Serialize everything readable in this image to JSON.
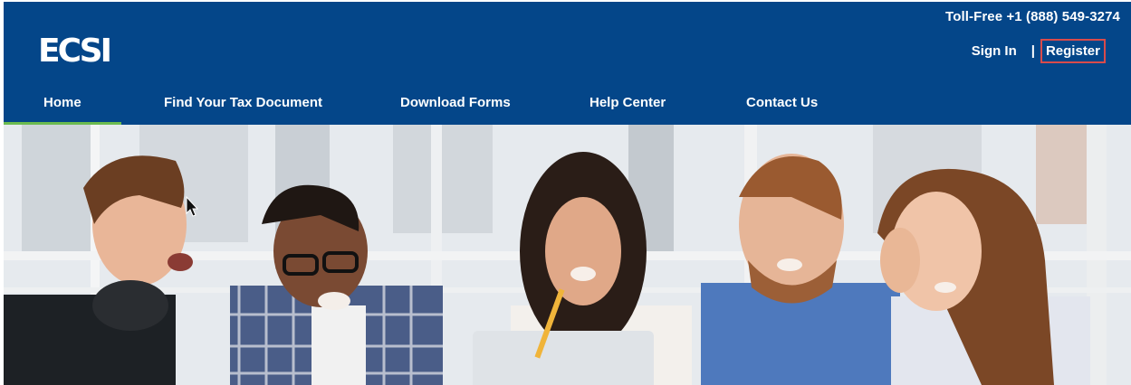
{
  "header": {
    "phone": "Toll-Free +1 (888) 549-3274",
    "logo": "ECSI",
    "signin": "Sign In",
    "separator": "|",
    "register": "Register"
  },
  "nav": {
    "items": [
      {
        "label": "Home",
        "active": true
      },
      {
        "label": "Find Your Tax Document",
        "active": false
      },
      {
        "label": "Download Forms",
        "active": false
      },
      {
        "label": "Help Center",
        "active": false
      },
      {
        "label": "Contact Us",
        "active": false
      }
    ]
  },
  "colors": {
    "header_bg": "#044689",
    "accent_green": "#6bbb4f",
    "register_highlight": "#d94b4b"
  },
  "icons": [
    "mouse-cursor-icon"
  ]
}
